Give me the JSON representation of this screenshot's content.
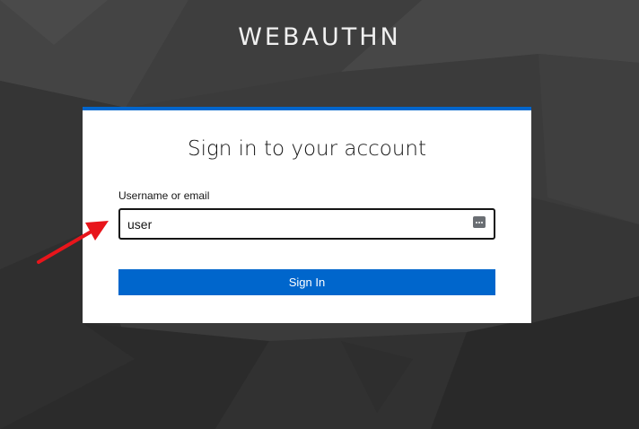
{
  "brand": {
    "title": "WEBAUTHN"
  },
  "login": {
    "heading": "Sign in to your account",
    "username_label": "Username or email",
    "username_value": "user",
    "submit_label": "Sign In"
  },
  "colors": {
    "accent": "#0066cc",
    "background": "#3a3a3a",
    "annotation_arrow": "#e8151b"
  },
  "icons": {
    "password_manager": "password-manager-key-icon",
    "annotation": "red-arrow-icon"
  }
}
